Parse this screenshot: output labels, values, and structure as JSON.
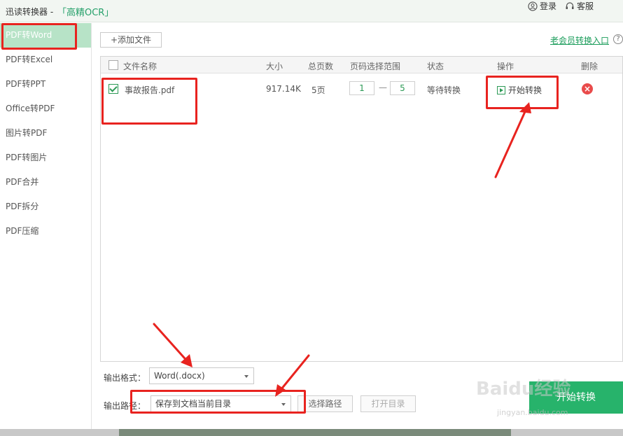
{
  "titlebar": {
    "app_title": "迅读转换器 -",
    "ocr_link": "「高精OCR」",
    "login": "登录",
    "service": "客服"
  },
  "sidebar": {
    "items": [
      {
        "label": "PDF转Word",
        "active": true
      },
      {
        "label": "PDF转Excel"
      },
      {
        "label": "PDF转PPT"
      },
      {
        "label": "Office转PDF"
      },
      {
        "label": "图片转PDF"
      },
      {
        "label": "PDF转图片"
      },
      {
        "label": "PDF合并"
      },
      {
        "label": "PDF拆分"
      },
      {
        "label": "PDF压缩"
      }
    ]
  },
  "toolbar": {
    "add_file": "+添加文件",
    "vip_link": "老会员转换入口",
    "help": "?"
  },
  "table": {
    "headers": {
      "name": "文件名称",
      "size": "大小",
      "pages": "总页数",
      "range": "页码选择范围",
      "status": "状态",
      "action": "操作",
      "delete": "删除"
    },
    "rows": [
      {
        "checked": true,
        "name": "事故报告.pdf",
        "size": "917.14K",
        "pages": "5页",
        "range_start": "1",
        "range_dash": "—",
        "range_end": "5",
        "status": "等待转换",
        "action": "开始转换",
        "delete": "×"
      }
    ]
  },
  "output": {
    "format_label": "输出格式：",
    "format_value": "Word(.docx)",
    "path_label": "输出路径：",
    "path_value": "保存到文档当前目录",
    "choose_path": "选择路径",
    "open_dir": "打开目录",
    "convert_all": "开始转换"
  },
  "watermark": {
    "text": "Baidu经验",
    "sub": "jingyan.baidu.com"
  },
  "colors": {
    "accent": "#27b36b",
    "annotation": "#e8231f"
  }
}
